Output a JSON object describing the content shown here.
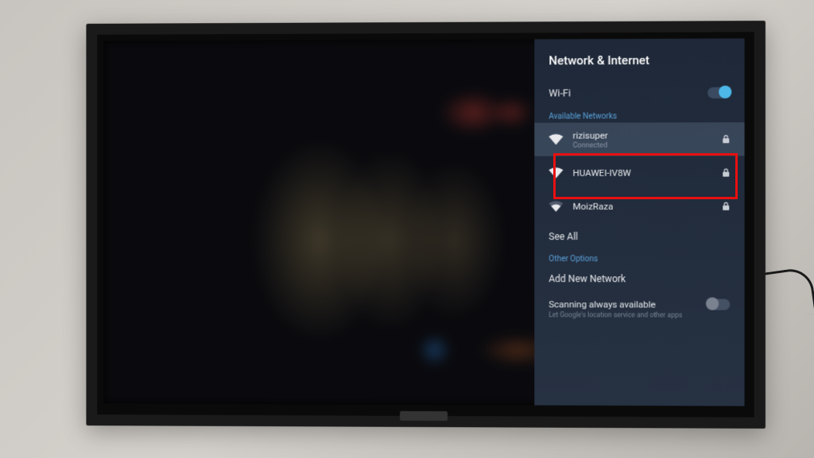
{
  "panel": {
    "title": "Network & Internet",
    "wifi_label": "Wi-Fi",
    "available_label": "Available Networks",
    "see_all": "See All",
    "other_options": "Other Options",
    "add_network": "Add New Network",
    "scanning_title": "Scanning always available",
    "scanning_sub": "Let Google's location service and other apps"
  },
  "networks": [
    {
      "name": "rizisuper",
      "status": "Connected",
      "signal": "full",
      "locked": true,
      "selected": true
    },
    {
      "name": "HUAWEI-IV8W",
      "status": "",
      "signal": "full",
      "locked": true,
      "selected": false
    },
    {
      "name": "MoizRaza",
      "status": "",
      "signal": "medium",
      "locked": true,
      "selected": false
    }
  ]
}
